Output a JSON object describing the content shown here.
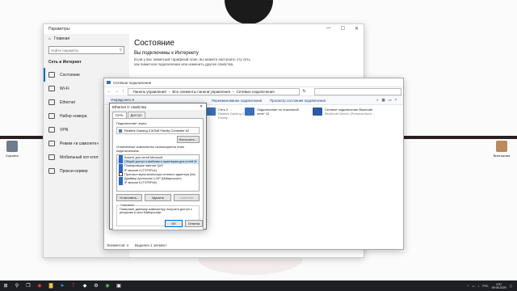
{
  "desktop": {
    "icons": [
      {
        "label": "Корзина"
      },
      {
        "label": "Винтажнаа"
      }
    ]
  },
  "settings": {
    "title": "Параметры",
    "home": "Главная",
    "search_placeholder": "Найти параметр",
    "section": "Сеть и Интернет",
    "items": [
      {
        "label": "Состояние",
        "icon": "home-icon"
      },
      {
        "label": "Wi-Fi",
        "icon": "wifi-icon"
      },
      {
        "label": "Ethernet",
        "icon": "ethernet-icon"
      },
      {
        "label": "Набор номера",
        "icon": "dialup-icon"
      },
      {
        "label": "VPN",
        "icon": "vpn-icon"
      },
      {
        "label": "Режим «в самолете»",
        "icon": "airplane-icon"
      },
      {
        "label": "Мобильный хот-спот",
        "icon": "hotspot-icon"
      },
      {
        "label": "Прокси-сервер",
        "icon": "globe-icon"
      }
    ],
    "content_title": "Состояние",
    "content_heading": "Вы подключены к Интернету",
    "content_text": "Если у вас лимитный тарифный план, вы можете настроить эту сеть как лимитное подключение или изменить другие свойства."
  },
  "explorer": {
    "title": "Сетевые подключения",
    "breadcrumb": [
      "Панель управления",
      "Все элементы панели управления",
      "Сетевые подключения"
    ],
    "commands": [
      "Упорядочить ▾",
      "Переименование подключения",
      "Просмотр состояния подключения"
    ],
    "connections": [
      {
        "name": "Сеть 2",
        "sub": "Realtek Gaming 2.5GbE Family"
      },
      {
        "name": "Подключение по локальной сети* 12",
        "sub": ""
      },
      {
        "name": "Сетевое подключение Bluetooth",
        "sub": "Bluetooth Device (Personal Area ..."
      }
    ],
    "status_count": "Элементов: 4",
    "status_selected": "Выделен 1 элемент"
  },
  "dialog": {
    "title": "Ethernet 2: свойства",
    "tabs": [
      "Сеть",
      "Доступ"
    ],
    "connect_via_label": "Подключение через:",
    "adapter": "Realtek Gaming 2.5GbE Family Controller #2",
    "configure_button": "Настроить...",
    "components_label": "Отмеченные компоненты используются этим подключением:",
    "components": [
      {
        "label": "Клиент для сетей Microsoft",
        "checked": true
      },
      {
        "label": "Общий доступ к файлам и принтерам для сетей M",
        "checked": true
      },
      {
        "label": "Планировщик пакетов QoS",
        "checked": true
      },
      {
        "label": "IP версии 4 (TCP/IPv4)",
        "checked": true
      },
      {
        "label": "Протокол мультиплексора сетевого адаптера (Ma",
        "checked": false
      },
      {
        "label": "Драйвер протокола LLDP (Майкрософт)",
        "checked": true
      },
      {
        "label": "IP версии 6 (TCP/IPv6)",
        "checked": true
      }
    ],
    "install_button": "Установить...",
    "remove_button": "Удалить",
    "properties_button": "Свойства",
    "description_legend": "Описание",
    "description_text": "Позволяет данному компьютеру получать доступ к ресурсам в сети Майкрософт.",
    "ok_button": "OK",
    "cancel_button": "Отмена"
  },
  "taskbar": {
    "lang": "РУС",
    "time": "2:57",
    "date": "09.05.2025"
  }
}
